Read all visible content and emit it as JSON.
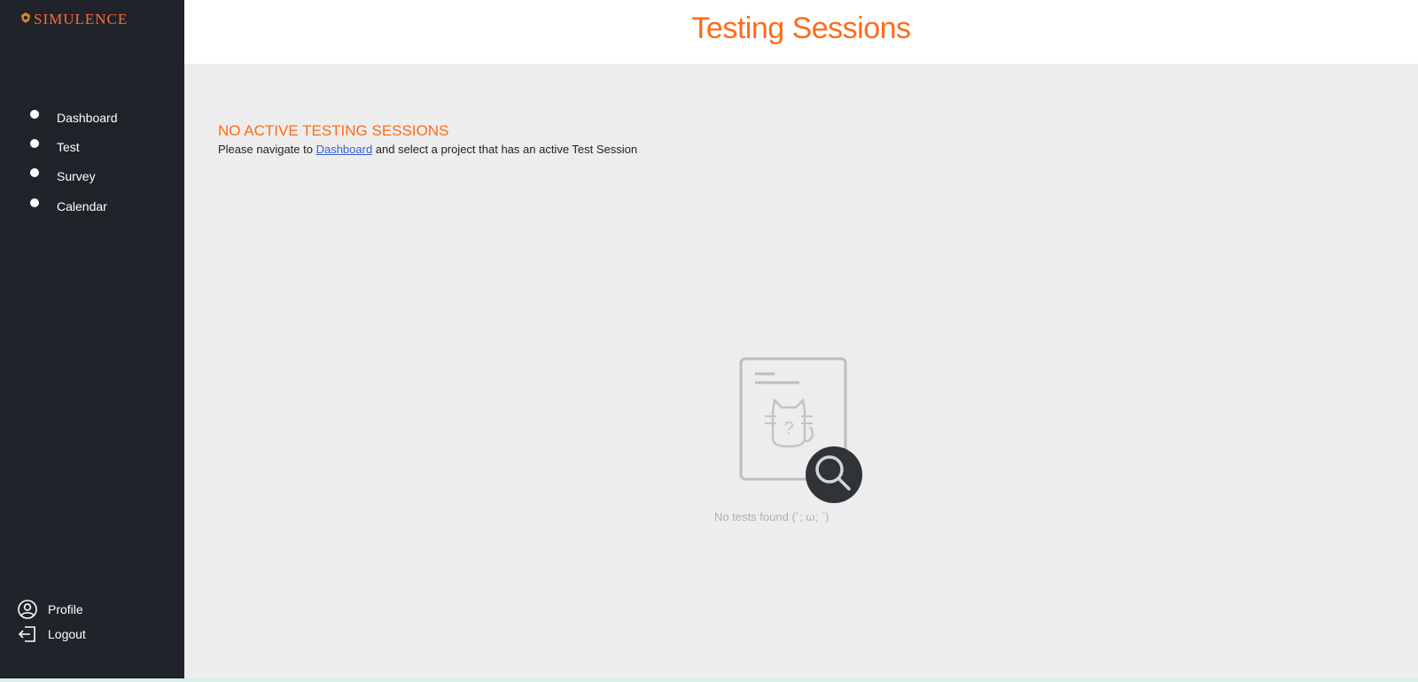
{
  "app": {
    "logo_text": "SIMULENCE"
  },
  "header": {
    "title": "Testing Sessions"
  },
  "sidebar": {
    "items": [
      {
        "label": "Dashboard"
      },
      {
        "label": "Test"
      },
      {
        "label": "Survey"
      },
      {
        "label": "Calendar"
      }
    ],
    "bottom": [
      {
        "label": "Profile",
        "icon": "user-circle-icon"
      },
      {
        "label": "Logout",
        "icon": "logout-icon"
      }
    ]
  },
  "main": {
    "heading": "NO ACTIVE TESTING SESSIONS",
    "text_before": "Please navigate to ",
    "link": "Dashboard",
    "text_after": " and select a project that has an active Test Session",
    "empty_caption": "No tests found (´; ω; `)"
  },
  "colors": {
    "accent": "#ff6b1a",
    "sidebar": "#202329",
    "link": "#3a62d8"
  }
}
